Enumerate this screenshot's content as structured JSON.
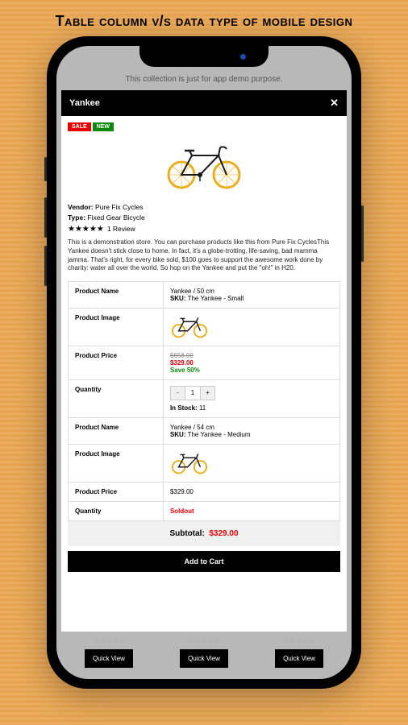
{
  "page_heading": "Table column v/s data type of mobile design",
  "demo_text": "This collection is just for app demo purpose.",
  "modal_title": "Yankee",
  "badges": {
    "sale": "SALE",
    "new": "NEW"
  },
  "vendor_label": "Vendor:",
  "vendor_value": "Pure Fix Cycles",
  "type_label": "Type:",
  "type_value": "Fixed Gear Bicycle",
  "review_count": "1 Review",
  "description": "This is a demonstration store. You can purchase products like this from Pure Fix CyclesThis Yankee doesn't stick close to home. In fact, it's a globe-trotting, life-saving, bad mamma jamma. That's right, for every bike sold, $100 goes to support the awesome work done by charity: water all over the world. So hop on the Yankee and put the \"oh!\" in H20.",
  "labels": {
    "product_name": "Product Name",
    "product_image": "Product Image",
    "product_price": "Product Price",
    "quantity": "Quantity",
    "sku": "SKU:",
    "in_stock": "In Stock:",
    "subtotal": "Subtotal:",
    "add_to_cart": "Add to Cart",
    "quick_view": "Quick View",
    "save": "Save"
  },
  "variants": [
    {
      "name": "Yankee / 50 cm",
      "sku": "The Yankee - Small",
      "compare_price": "$658.00",
      "price": "$329.00",
      "save_pct": "50%",
      "qty": "1",
      "stock": "11",
      "soldout": false
    },
    {
      "name": "Yankee / 54 cm",
      "sku": "The Yankee - Medium",
      "price": "$329.00",
      "soldout": true,
      "soldout_text": "Soldout"
    }
  ],
  "subtotal_value": "$329.00"
}
